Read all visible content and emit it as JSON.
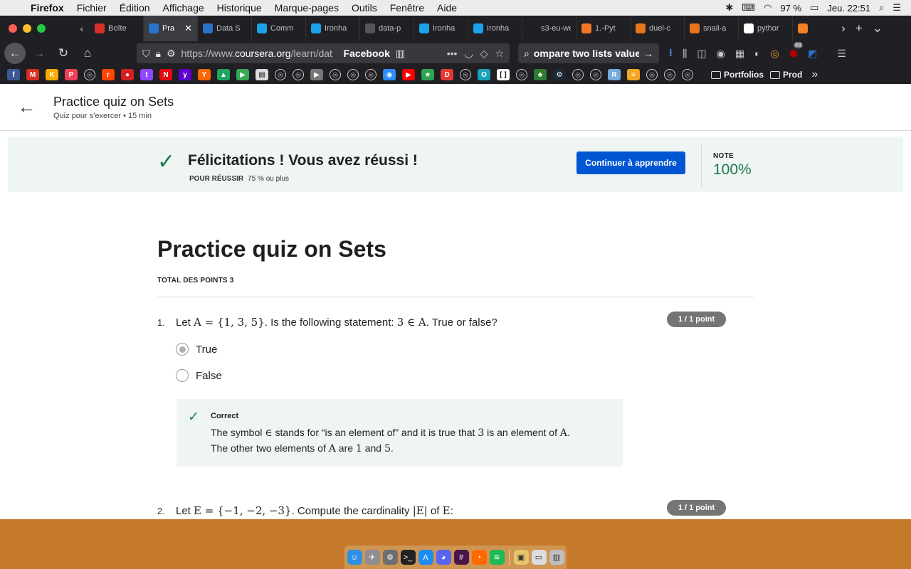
{
  "menubar": {
    "app": "Firefox",
    "items": [
      "Fichier",
      "Édition",
      "Affichage",
      "Historique",
      "Marque-pages",
      "Outils",
      "Fenêtre",
      "Aide"
    ],
    "battery": "97 %",
    "clock": "Jeu. 22:51"
  },
  "tabs": [
    {
      "label": "Boîte",
      "icon": "gmail-icon",
      "color": "#d93025"
    },
    {
      "label": "Pra",
      "icon": "coursera-icon",
      "color": "#2a73cc",
      "active": true
    },
    {
      "label": "Data S",
      "icon": "coursera-icon",
      "color": "#2a73cc"
    },
    {
      "label": "Comm",
      "icon": "hexagon-icon",
      "color": "#1aa3e8"
    },
    {
      "label": "Ironha",
      "icon": "hexagon-icon",
      "color": "#1aa3e8"
    },
    {
      "label": "data-p",
      "icon": "github-icon",
      "color": "#555555"
    },
    {
      "label": "Ironha",
      "icon": "hexagon-icon",
      "color": "#1aa3e8"
    },
    {
      "label": "Ironha",
      "icon": "hexagon-icon",
      "color": "#1aa3e8"
    },
    {
      "label": "s3-eu-wes",
      "icon": "blank-icon",
      "color": "#1f1f24"
    },
    {
      "label": "1.-Pyt",
      "icon": "jupyter-icon",
      "color": "#f37626"
    },
    {
      "label": "duel-c",
      "icon": "notebook-icon",
      "color": "#e8741c"
    },
    {
      "label": "snail-a",
      "icon": "notebook-icon",
      "color": "#e8741c"
    },
    {
      "label": "pythor",
      "icon": "google-icon",
      "color": "#ffffff"
    },
    {
      "label": "",
      "icon": "stackoverflow-icon",
      "color": "#f48024"
    }
  ],
  "tab_close_glyph": "✕",
  "navbar": {
    "url_prefix": "https://www.",
    "url_domain": "coursera.org",
    "url_path": "/learn/dat",
    "site_label": "Facebook",
    "search_text": "ompare two lists value"
  },
  "bookmarks": {
    "icons": [
      {
        "name": "facebook",
        "color": "#3b5998",
        "glyph": "f"
      },
      {
        "name": "gmail",
        "color": "#d93025",
        "glyph": "M"
      },
      {
        "name": "keep",
        "color": "#f9ab00",
        "glyph": "K"
      },
      {
        "name": "pocket",
        "color": "#ef4056",
        "glyph": "P"
      },
      {
        "name": "globe",
        "color": "",
        "glyph": "◎"
      },
      {
        "name": "reddit",
        "color": "#ff4500",
        "glyph": "r"
      },
      {
        "name": "record",
        "color": "#d62020",
        "glyph": "●"
      },
      {
        "name": "twitch",
        "color": "#9146ff",
        "glyph": "t"
      },
      {
        "name": "netflix",
        "color": "#e50914",
        "glyph": "N"
      },
      {
        "name": "yahoo",
        "color": "#6001d2",
        "glyph": "y"
      },
      {
        "name": "ycombinator",
        "color": "#ff6600",
        "glyph": "Y"
      },
      {
        "name": "drive",
        "color": "#1fa463",
        "glyph": "▲"
      },
      {
        "name": "play",
        "color": "#34a853",
        "glyph": "▶"
      },
      {
        "name": "calendar",
        "color": "#dddddd",
        "glyph": "▤"
      },
      {
        "name": "globe",
        "color": "",
        "glyph": "◎"
      },
      {
        "name": "globe",
        "color": "",
        "glyph": "◎"
      },
      {
        "name": "arrow",
        "color": "#777777",
        "glyph": "▶"
      },
      {
        "name": "globe",
        "color": "",
        "glyph": "◎"
      },
      {
        "name": "globe",
        "color": "",
        "glyph": "◎"
      },
      {
        "name": "globe",
        "color": "",
        "glyph": "◎"
      },
      {
        "name": "zoom",
        "color": "#2d8cff",
        "glyph": "◉"
      },
      {
        "name": "youtube",
        "color": "#ff0000",
        "glyph": "▶"
      },
      {
        "name": "star",
        "color": "#2ea44f",
        "glyph": "★"
      },
      {
        "name": "d",
        "color": "#e53935",
        "glyph": "D"
      },
      {
        "name": "globe",
        "color": "",
        "glyph": "◎"
      },
      {
        "name": "o",
        "color": "#1aa3b8",
        "glyph": "O"
      },
      {
        "name": "bracket",
        "color": "#ffffff",
        "glyph": "[ ]"
      },
      {
        "name": "globe",
        "color": "",
        "glyph": "◎"
      },
      {
        "name": "plant",
        "color": "#2e7d32",
        "glyph": "♣"
      },
      {
        "name": "steam",
        "color": "#1b2838",
        "glyph": "⚙"
      },
      {
        "name": "globe",
        "color": "",
        "glyph": "◎"
      },
      {
        "name": "globe",
        "color": "",
        "glyph": "◎"
      },
      {
        "name": "rstudio",
        "color": "#75aadb",
        "glyph": "R"
      },
      {
        "name": "stripes",
        "color": "#f5a623",
        "glyph": "≡"
      },
      {
        "name": "globe",
        "color": "",
        "glyph": "◎"
      },
      {
        "name": "globe",
        "color": "",
        "glyph": "◎"
      },
      {
        "name": "globe",
        "color": "",
        "glyph": "◎"
      }
    ],
    "folders": [
      "Portfolios",
      "Prod"
    ]
  },
  "page_header": {
    "title": "Practice quiz on Sets",
    "subtitle": "Quiz pour s'exercer • 15  min"
  },
  "banner": {
    "message": "Félicitations ! Vous avez réussi !",
    "pass_label": "POUR RÉUSSIR",
    "pass_value": "75 % ou plus",
    "cta": "Continuer à apprendre",
    "grade_label": "NOTE",
    "grade_value": "100%"
  },
  "quiz": {
    "title": "Practice quiz on Sets",
    "total_points": "TOTAL DES POINTS 3",
    "questions": [
      {
        "number": "1.",
        "text_1": "Let ",
        "math_1": "A = {1, 3, 5}",
        "text_2": ". Is the following statement: ",
        "math_2": "3 ∈ A",
        "text_3": ". True or false?",
        "points": "1 / 1 point",
        "options": [
          {
            "label": "True",
            "selected": true
          },
          {
            "label": "False",
            "selected": false
          }
        ],
        "feedback": {
          "label": "Correct",
          "l1_a": "The symbol ",
          "l1_m1": "∈",
          "l1_b": " stands for “is an element of” and it is true that ",
          "l1_m2": "3",
          "l1_c": " is an element of ",
          "l1_m3": "A",
          "l1_d": ".",
          "l2_a": "The other two elements of ",
          "l2_m1": "A",
          "l2_b": " are ",
          "l2_m2": "1",
          "l2_c": " and ",
          "l2_m3": "5",
          "l2_d": "."
        }
      },
      {
        "number": "2.",
        "text_1": "Let ",
        "math_1": "E = {−1, −2, −3}",
        "text_2": ". Compute the cardinality ",
        "math_2": "|E|",
        "text_3": " of ",
        "math_3": "E",
        "text_4": ":",
        "points": "1 / 1 point"
      }
    ]
  },
  "dock": {
    "apps": [
      {
        "name": "finder",
        "color": "#2d8fe6",
        "glyph": "☺"
      },
      {
        "name": "launchpad",
        "color": "#8e8e93",
        "glyph": "✈"
      },
      {
        "name": "system-preferences",
        "color": "#6e6e73",
        "glyph": "⚙"
      },
      {
        "name": "terminal",
        "color": "#222222",
        "glyph": ">_"
      },
      {
        "name": "app-store",
        "color": "#1c8cf0",
        "glyph": "A"
      },
      {
        "name": "discord",
        "color": "#5865f2",
        "glyph": "◕"
      },
      {
        "name": "slack",
        "color": "#4a154b",
        "glyph": "#"
      },
      {
        "name": "firefox",
        "color": "#ff6a00",
        "glyph": "◔"
      },
      {
        "name": "spotify",
        "color": "#1db954",
        "glyph": "≋"
      },
      {
        "name": "preview",
        "color": "#e8c36a",
        "glyph": "▣"
      },
      {
        "name": "documents",
        "color": "#dddddd",
        "glyph": "▭"
      },
      {
        "name": "trash",
        "color": "#bfbfbf",
        "glyph": "▥"
      }
    ]
  }
}
